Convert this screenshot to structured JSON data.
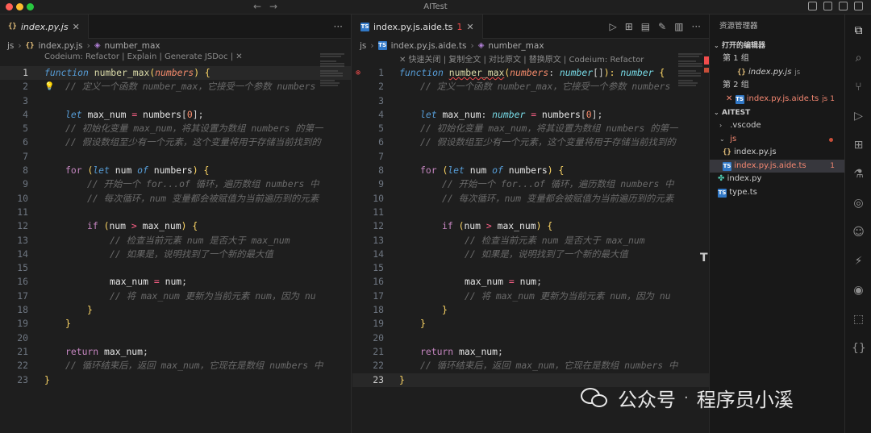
{
  "window": {
    "title": "AITest"
  },
  "left": {
    "tab": {
      "label": "index.py.js"
    },
    "breadcrumb": [
      "js",
      "index.py.js",
      "number_max"
    ],
    "codelens": "Codeium: Refactor | Explain | Generate JSDoc | ✕",
    "lines": [
      {
        "n": "1"
      },
      {
        "n": "2"
      },
      {
        "n": "3"
      },
      {
        "n": "4"
      },
      {
        "n": "5"
      },
      {
        "n": "6"
      },
      {
        "n": "7"
      },
      {
        "n": "8"
      },
      {
        "n": "9"
      },
      {
        "n": "10"
      },
      {
        "n": "11"
      },
      {
        "n": "12"
      },
      {
        "n": "13"
      },
      {
        "n": "14"
      },
      {
        "n": "15"
      },
      {
        "n": "16"
      },
      {
        "n": "17"
      },
      {
        "n": "18"
      },
      {
        "n": "19"
      },
      {
        "n": "20"
      },
      {
        "n": "21"
      },
      {
        "n": "22"
      },
      {
        "n": "23"
      }
    ],
    "code": {
      "l1": [
        "function",
        "number_max",
        "(",
        "numbers",
        ")",
        " {"
      ],
      "l2": "// 定义一个函数 number_max，它接受一个参数 numbers",
      "l4": [
        "let",
        "max_num",
        "=",
        "numbers",
        "[",
        "0",
        "];"
      ],
      "l5": "// 初始化变量 max_num，将其设置为数组 numbers 的第一",
      "l6": "// 假设数组至少有一个元素，这个变量将用于存储当前找到的",
      "l8": [
        "for",
        "(",
        "let",
        "num",
        "of",
        "numbers",
        ")",
        " {"
      ],
      "l9": "// 开始一个 for...of 循环，遍历数组 numbers 中",
      "l10": "// 每次循环，num 变量都会被赋值为当前遍历到的元素",
      "l12": [
        "if",
        "(",
        "num",
        ">",
        "max_num",
        ")",
        " {"
      ],
      "l13": "// 检查当前元素 num 是否大于 max_num",
      "l14": "// 如果是，说明找到了一个新的最大值",
      "l16": [
        "max_num",
        "=",
        "num",
        ";"
      ],
      "l17": "// 将 max_num 更新为当前元素 num，因为 nu",
      "l18": "}",
      "l19": "}",
      "l21": [
        "return",
        "max_num",
        ";"
      ],
      "l22": "// 循环结束后，返回 max_num，它现在是数组 numbers 中",
      "l23": "}"
    }
  },
  "right": {
    "tab": {
      "label": "index.py.js.aide.ts",
      "count": "1"
    },
    "breadcrumb": [
      "js",
      "index.py.js.aide.ts",
      "number_max"
    ],
    "codelens": "✕ 快速关闭 | 复制全文 | 对比原文 | 替换原文 | Codeium: Refactor",
    "code": {
      "l1": [
        "function",
        "number_max",
        "(",
        "numbers",
        ": ",
        "number",
        "[]",
        "): ",
        "number",
        " {"
      ],
      "l2": "// 定义一个函数 number_max，它接受一个参数 numbers",
      "l4": [
        "let",
        "max_num",
        ": ",
        "number",
        "=",
        "numbers",
        "[",
        "0",
        "];"
      ],
      "l5": "// 初始化变量 max_num，将其设置为数组 numbers 的第一",
      "l6": "// 假设数组至少有一个元素，这个变量将用于存储当前找到的",
      "l8": [
        "for",
        "(",
        "let",
        "num",
        "of",
        "numbers",
        ")",
        " {"
      ],
      "l9": "// 开始一个 for...of 循环，遍历数组 numbers 中",
      "l10": "// 每次循环，num 变量都会被赋值为当前遍历到的元素",
      "l12": [
        "if",
        "(",
        "num",
        ">",
        "max_num",
        ")",
        " {"
      ],
      "l13": "// 检查当前元素 num 是否大于 max_num",
      "l14": "// 如果是，说明找到了一个新的最大值",
      "l16": [
        "max_num",
        "=",
        "num",
        ";"
      ],
      "l17": "// 将 max_num 更新为当前元素 num，因为 nu",
      "l18": "}",
      "l19": "}",
      "l21": [
        "return",
        "max_num",
        ";"
      ],
      "l22": "// 循环结束后，返回 max_num，它现在是数组 numbers 中",
      "l23": "}"
    }
  },
  "sidebar": {
    "title": "资源管理器",
    "open_editors": "打开的编辑器",
    "group1": "第 1 组",
    "group1_file": "index.py.js",
    "group1_file_dir": "js",
    "group2": "第 2 组",
    "group2_file": "index.py.js.aide.ts",
    "group2_file_dir": "js",
    "group2_badge": "1",
    "project": "AITEST",
    "tree": {
      "vscode": ".vscode",
      "js": "js",
      "indexpyjs": "index.py.js",
      "aide": "index.py.js.aide.ts",
      "aide_badge": "1",
      "indexpy": "index.py",
      "typets": "type.ts"
    }
  },
  "watermark": {
    "text": "公众号",
    "dot": "·",
    "name": "程序员小溪"
  },
  "colors": {
    "accent": "#569cd6",
    "error": "#f14c4c",
    "function": "#dcdcaa"
  }
}
